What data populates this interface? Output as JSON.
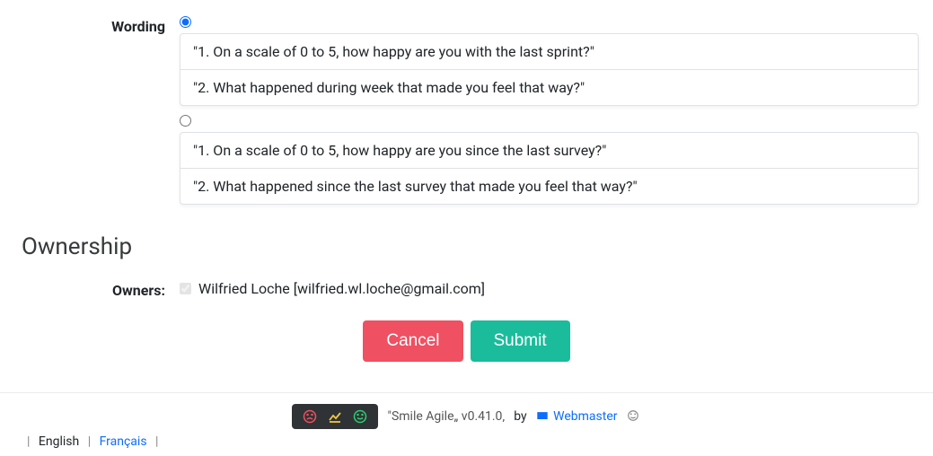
{
  "form": {
    "wording_label": "Wording",
    "options": [
      {
        "selected": true,
        "items": [
          "\"1. On a scale of 0 to 5, how happy are you with the last sprint?\"",
          "\"2. What happened during week that made you feel that way?\""
        ]
      },
      {
        "selected": false,
        "items": [
          "\"1. On a scale of 0 to 5, how happy are you since the last survey?\"",
          "\"2. What happened since the last survey that made you feel that way?\""
        ]
      }
    ]
  },
  "ownership": {
    "heading": "Ownership",
    "owners_label": "Owners:",
    "owner_checked": true,
    "owner_disabled": true,
    "owner_text": "Wilfried Loche [wilfried.wl.loche@gmail.com]"
  },
  "buttons": {
    "cancel": "Cancel",
    "submit": "Submit"
  },
  "footer": {
    "app_quote": "\"Smile Agile„ v0.41.0‚",
    "by_text": "by",
    "webmaster": "Webmaster",
    "lang_english": "English",
    "lang_francais": "Français"
  }
}
